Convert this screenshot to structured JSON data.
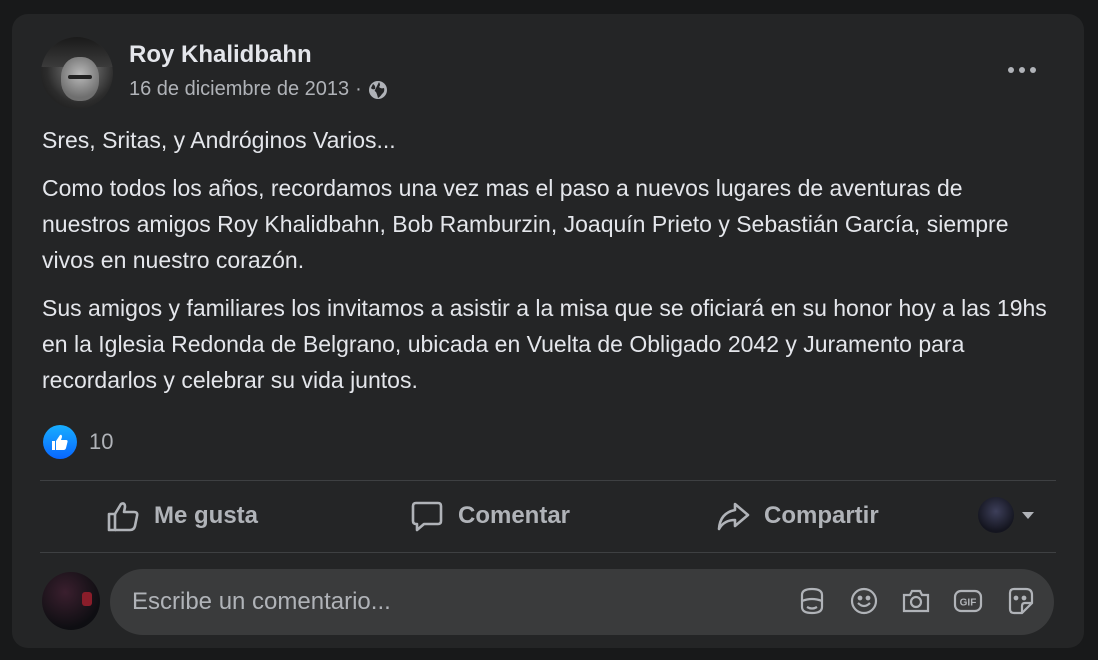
{
  "post": {
    "author": "Roy Khalidbahn",
    "date": "16 de diciembre de 2013",
    "separator": "·",
    "audience_icon": "globe-icon",
    "paragraphs": [
      "Sres, Sritas, y Andróginos Varios...",
      "Como todos los años, recordamos una vez mas el paso a nuevos lugares de aventuras de nuestros amigos Roy Khalidbahn, Bob Ramburzin, Joaquín Prieto y Sebastián García, siempre vivos en nuestro corazón.",
      "Sus amigos y familiares los invitamos a asistir a la misa que se oficiará en su honor hoy a las 19hs en la Iglesia Redonda de Belgrano, ubicada en Vuelta de Obligado 2042 y Juramento para recordarlos y celebrar su vida juntos."
    ]
  },
  "reactions": {
    "count": "10",
    "icon": "like-reaction-icon"
  },
  "actions": {
    "like": "Me gusta",
    "comment": "Comentar",
    "share": "Compartir"
  },
  "comment_box": {
    "placeholder": "Escribe un comentario...",
    "icons": [
      "avatar-sticker-icon",
      "emoji-icon",
      "camera-icon",
      "gif-icon",
      "sticker-icon"
    ]
  },
  "colors": {
    "background": "#18191a",
    "card": "#242526",
    "text_primary": "#e4e6eb",
    "text_secondary": "#b0b3b8",
    "accent": "#0866ff"
  }
}
